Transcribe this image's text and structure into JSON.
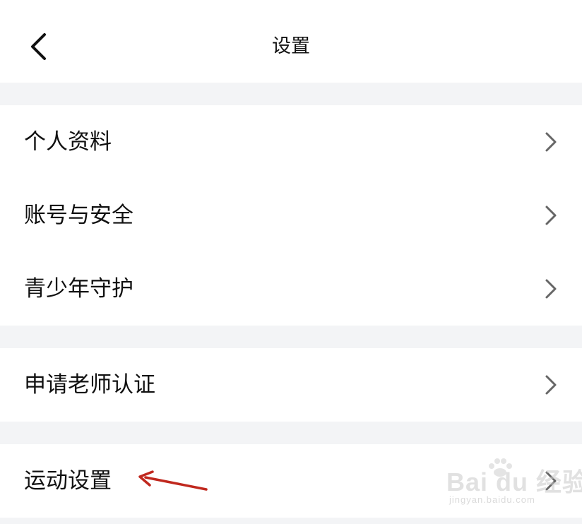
{
  "header": {
    "title": "设置",
    "back_icon": "chevron-left-icon"
  },
  "sections": [
    {
      "items": [
        {
          "label": "个人资料",
          "icon": "chevron-right-icon"
        },
        {
          "label": "账号与安全",
          "icon": "chevron-right-icon"
        },
        {
          "label": "青少年守护",
          "icon": "chevron-right-icon"
        }
      ]
    },
    {
      "items": [
        {
          "label": "申请老师认证",
          "icon": "chevron-right-icon"
        }
      ]
    },
    {
      "items": [
        {
          "label": "运动设置",
          "icon": "chevron-right-icon"
        }
      ]
    }
  ],
  "annotation": {
    "type": "arrow",
    "color": "#c0281e",
    "points_to": "运动设置"
  },
  "watermark": {
    "brand": "Bai du 经验",
    "url": "jingyan.baidu.com"
  },
  "colors": {
    "background": "#f3f4f6",
    "surface": "#ffffff",
    "text": "#111111",
    "chevron": "#666666"
  }
}
